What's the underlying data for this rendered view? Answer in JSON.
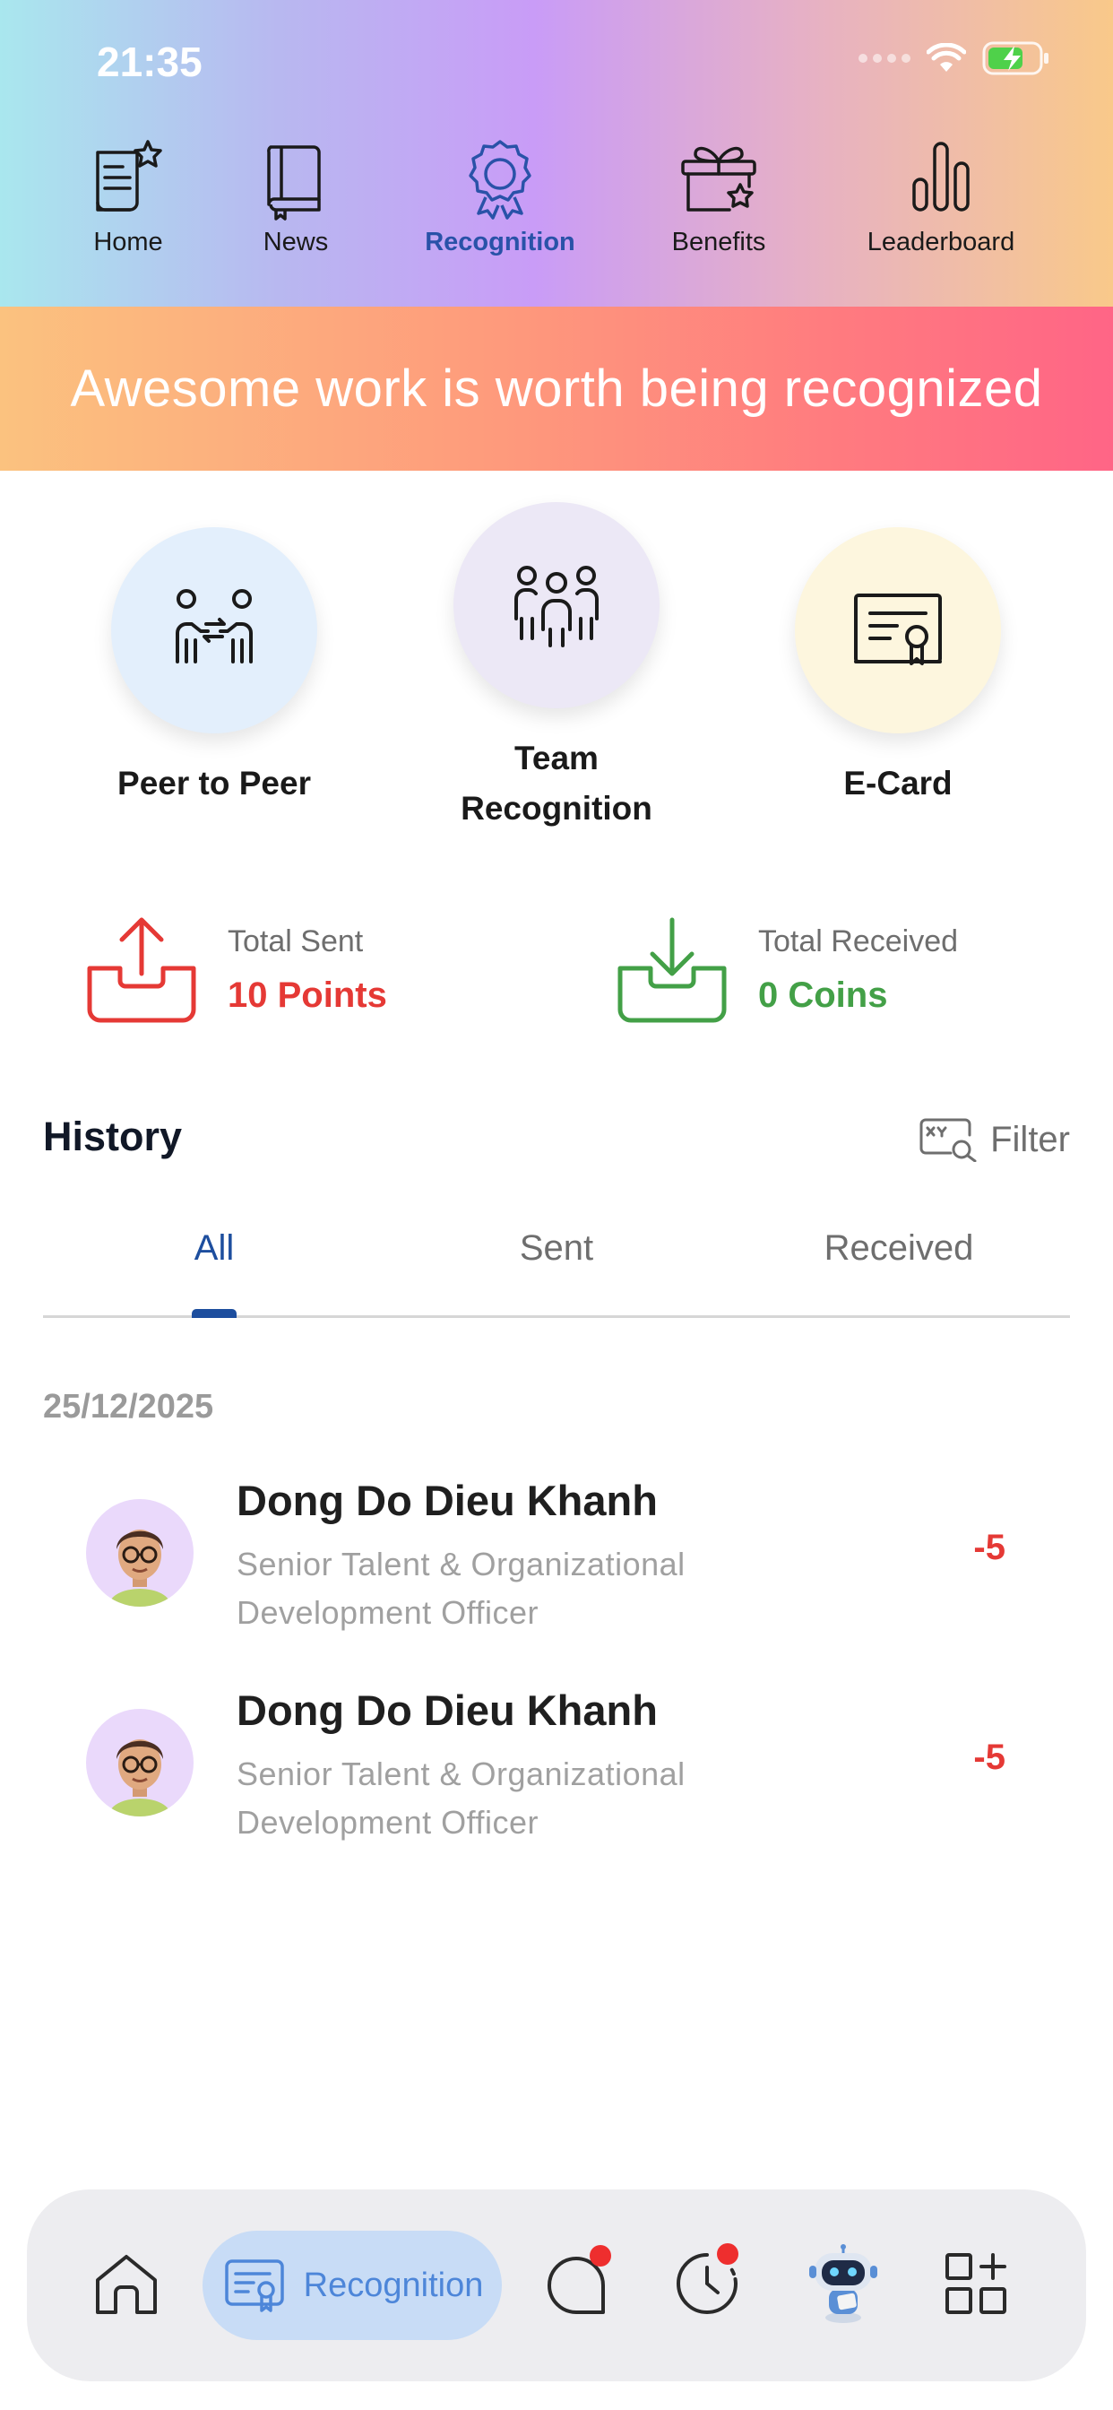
{
  "status_bar": {
    "time": "21:35"
  },
  "top_nav": {
    "items": [
      {
        "label": "Home",
        "icon": "home-document-star-icon"
      },
      {
        "label": "News",
        "icon": "book-icon"
      },
      {
        "label": "Recognition",
        "icon": "award-badge-icon",
        "active": true
      },
      {
        "label": "Benefits",
        "icon": "gift-star-icon"
      },
      {
        "label": "Leaderboard",
        "icon": "bar-chart-icon"
      }
    ]
  },
  "banner": {
    "text": "Awesome work is worth being recognized"
  },
  "actions": [
    {
      "label": "Peer to Peer",
      "icon": "peer-exchange-icon",
      "color": "#e3effc"
    },
    {
      "label": "Team Recognition",
      "icon": "team-icon",
      "color": "#ece8f6"
    },
    {
      "label": "E-Card",
      "icon": "certificate-icon",
      "color": "#fdf6de"
    }
  ],
  "stats": {
    "sent": {
      "caption": "Total Sent",
      "value": "10 Points",
      "color": "#e53935"
    },
    "received": {
      "caption": "Total Received",
      "value": "0 Coins",
      "color": "#43a047"
    }
  },
  "history": {
    "title": "History",
    "filter_label": "Filter",
    "tabs": [
      {
        "label": "All",
        "active": true
      },
      {
        "label": "Sent"
      },
      {
        "label": "Received"
      }
    ],
    "date": "25/12/2025",
    "entries": [
      {
        "name": "Dong Do Dieu Khanh",
        "role": "Senior Talent & Organizational Development Officer",
        "amount": "-5"
      },
      {
        "name": "Dong Do Dieu Khanh",
        "role": "Senior Talent & Organizational Development Officer",
        "amount": "-5"
      }
    ]
  },
  "bottom_bar": {
    "active_label": "Recognition",
    "items": [
      "home-icon",
      "recognition-icon",
      "chat-icon",
      "clock-icon",
      "robot-assistant-icon",
      "apps-grid-icon"
    ]
  },
  "colors": {
    "accent_blue": "#1d4e9e",
    "negative_red": "#e53935",
    "positive_green": "#43a047"
  }
}
